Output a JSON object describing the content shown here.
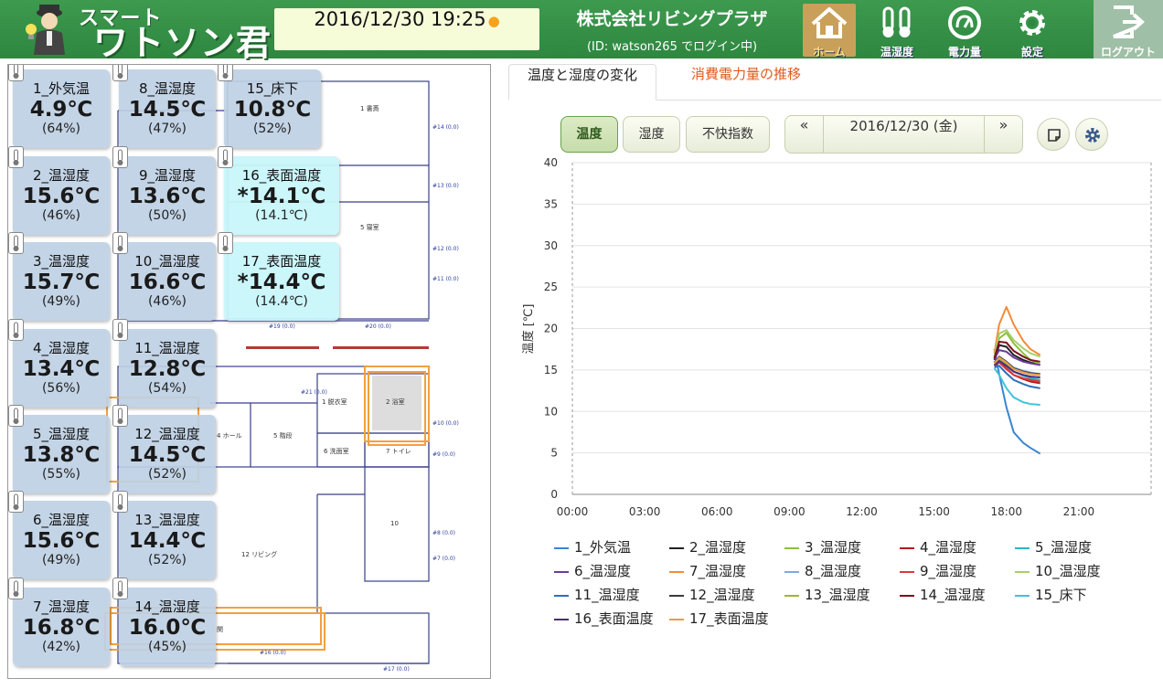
{
  "header": {
    "logo_line1": "スマート",
    "logo_line2": "ワトソン君",
    "datetime": "2016/12/30 19:25",
    "company": "株式会社リビングプラザ",
    "login_id": "(ID: watson265 でログイン中)",
    "nav": [
      {
        "label": "ホーム",
        "icon": "home-icon"
      },
      {
        "label": "温湿度",
        "icon": "thermometer-icon"
      },
      {
        "label": "電力量",
        "icon": "power-meter-icon"
      },
      {
        "label": "設定",
        "icon": "gear-icon"
      }
    ],
    "logout_label": "ログアウト"
  },
  "floorplan_labels": {
    "rooms": [
      "1 書斎",
      "5 寝室",
      "1 脱衣室",
      "2 浴室",
      "4 ホール",
      "5 階段",
      "6 洗面室",
      "7 トイレ",
      "10",
      "12 リビング",
      "関"
    ],
    "markers": [
      "#14 (0.0)",
      "#13 (0.0)",
      "#12 (0.0)",
      "#11 (0.0)",
      "#19 (0.0)",
      "#20 (0.0)",
      "#21 (0.0)",
      "#10 (0.0)",
      "#9 (0.0)",
      "#8 (0.0)",
      "#7 (0.0)",
      "#16 (0.0)",
      "#17 (0.0)"
    ]
  },
  "sensors": [
    {
      "name": "1_外気温",
      "temp": "4.9℃",
      "sub": "(64%)"
    },
    {
      "name": "2_温湿度",
      "temp": "15.6℃",
      "sub": "(46%)"
    },
    {
      "name": "3_温湿度",
      "temp": "15.7℃",
      "sub": "(49%)"
    },
    {
      "name": "4_温湿度",
      "temp": "13.4℃",
      "sub": "(56%)"
    },
    {
      "name": "5_温湿度",
      "temp": "13.8℃",
      "sub": "(55%)"
    },
    {
      "name": "6_温湿度",
      "temp": "15.6℃",
      "sub": "(49%)"
    },
    {
      "name": "7_温湿度",
      "temp": "16.8℃",
      "sub": "(42%)"
    },
    {
      "name": "8_温湿度",
      "temp": "14.5℃",
      "sub": "(47%)"
    },
    {
      "name": "9_温湿度",
      "temp": "13.6℃",
      "sub": "(50%)"
    },
    {
      "name": "10_温湿度",
      "temp": "16.6℃",
      "sub": "(46%)"
    },
    {
      "name": "11_温湿度",
      "temp": "12.8℃",
      "sub": "(54%)"
    },
    {
      "name": "12_温湿度",
      "temp": "14.5℃",
      "sub": "(52%)"
    },
    {
      "name": "13_温湿度",
      "temp": "14.4℃",
      "sub": "(52%)"
    },
    {
      "name": "14_温湿度",
      "temp": "16.0℃",
      "sub": "(45%)"
    },
    {
      "name": "15_床下",
      "temp": "10.8℃",
      "sub": "(52%)"
    },
    {
      "name": "16_表面温度",
      "temp": "*14.1℃",
      "sub": "(14.1℃)"
    },
    {
      "name": "17_表面温度",
      "temp": "*14.4℃",
      "sub": "(14.4℃)"
    }
  ],
  "tabs": [
    "温度と湿度の変化",
    "消費電力量の推移"
  ],
  "toolbar": {
    "temp": "温度",
    "humid": "湿度",
    "discomfort": "不快指数",
    "prev": "«",
    "date": "2016/12/30 (金)",
    "next": "»",
    "note_icon": "note-icon",
    "gear_icon": "gear-icon"
  },
  "chart_data": {
    "type": "line",
    "ylabel": "温度 [℃]",
    "xlabel": "",
    "ylim": [
      0,
      40
    ],
    "yticks": [
      0,
      5,
      10,
      15,
      20,
      25,
      30,
      35,
      40
    ],
    "xticks": [
      "00:00",
      "03:00",
      "06:00",
      "09:00",
      "12:00",
      "15:00",
      "18:00",
      "21:00"
    ],
    "xlim_hours": [
      0,
      24
    ],
    "grid": true,
    "legend_position": "bottom",
    "series": [
      {
        "name": "1_外気温",
        "color": "#3a86d0",
        "x": [
          17.5,
          17.7,
          18.0,
          18.3,
          18.7,
          19.0,
          19.4
        ],
        "y": [
          17.5,
          14.5,
          10.5,
          7.5,
          6.2,
          5.6,
          4.9
        ]
      },
      {
        "name": "2_温湿度",
        "color": "#222222",
        "x": [
          17.5,
          17.7,
          18.0,
          18.3,
          18.7,
          19.0,
          19.4
        ],
        "y": [
          16.2,
          18.0,
          17.8,
          16.8,
          16.2,
          15.9,
          15.6
        ]
      },
      {
        "name": "3_温湿度",
        "color": "#8ebf3f",
        "x": [
          17.5,
          17.7,
          18.0,
          18.3,
          18.7,
          19.0,
          19.4
        ],
        "y": [
          16.5,
          18.8,
          19.5,
          18.2,
          17.0,
          16.2,
          15.7
        ]
      },
      {
        "name": "4_温湿度",
        "color": "#b01c1c",
        "x": [
          17.5,
          17.7,
          18.0,
          18.3,
          18.7,
          19.0,
          19.4
        ],
        "y": [
          15.6,
          16.0,
          15.2,
          14.4,
          13.9,
          13.6,
          13.4
        ]
      },
      {
        "name": "5_温湿度",
        "color": "#2bb4c8",
        "x": [
          17.5,
          17.7,
          18.0,
          18.3,
          18.7,
          19.0,
          19.4
        ],
        "y": [
          15.8,
          16.4,
          15.6,
          14.8,
          14.3,
          14.0,
          13.8
        ]
      },
      {
        "name": "6_温湿度",
        "color": "#6a3d9a",
        "x": [
          17.5,
          17.7,
          18.0,
          18.3,
          18.7,
          19.0,
          19.4
        ],
        "y": [
          16.3,
          17.4,
          17.2,
          16.5,
          16.0,
          15.8,
          15.6
        ]
      },
      {
        "name": "7_温湿度",
        "color": "#f28c38",
        "x": [
          17.5,
          17.7,
          18.0,
          18.3,
          18.7,
          19.0,
          19.4
        ],
        "y": [
          17.0,
          20.5,
          22.6,
          20.5,
          18.5,
          17.5,
          16.8
        ]
      },
      {
        "name": "8_温湿度",
        "color": "#7fa8e0",
        "x": [
          17.5,
          17.7,
          18.0,
          18.3,
          18.7,
          19.0,
          19.4
        ],
        "y": [
          15.8,
          16.6,
          16.0,
          15.3,
          14.9,
          14.7,
          14.5
        ]
      },
      {
        "name": "9_温湿度",
        "color": "#d93a3a",
        "x": [
          17.5,
          17.7,
          18.0,
          18.3,
          18.7,
          19.0,
          19.4
        ],
        "y": [
          15.5,
          15.9,
          15.1,
          14.4,
          14.0,
          13.8,
          13.6
        ]
      },
      {
        "name": "10_温湿度",
        "color": "#a8cf6a",
        "x": [
          17.5,
          17.7,
          18.0,
          18.3,
          18.7,
          19.0,
          19.4
        ],
        "y": [
          16.6,
          19.4,
          19.8,
          18.6,
          17.6,
          17.0,
          16.6
        ]
      },
      {
        "name": "11_温湿度",
        "color": "#2f6fb8",
        "x": [
          17.5,
          17.7,
          18.0,
          18.3,
          18.7,
          19.0,
          19.4
        ],
        "y": [
          15.3,
          15.5,
          14.6,
          13.8,
          13.3,
          13.0,
          12.8
        ]
      },
      {
        "name": "12_温湿度",
        "color": "#3b3b3b",
        "x": [
          17.5,
          17.7,
          18.0,
          18.3,
          18.7,
          19.0,
          19.4
        ],
        "y": [
          15.9,
          16.6,
          16.0,
          15.2,
          14.8,
          14.6,
          14.5
        ]
      },
      {
        "name": "13_温湿度",
        "color": "#9db82a",
        "x": [
          17.5,
          17.7,
          18.0,
          18.3,
          18.7,
          19.0,
          19.4
        ],
        "y": [
          15.8,
          16.4,
          15.8,
          15.1,
          14.7,
          14.5,
          14.4
        ]
      },
      {
        "name": "14_温湿度",
        "color": "#7a1020",
        "x": [
          17.5,
          17.7,
          18.0,
          18.3,
          18.7,
          19.0,
          19.4
        ],
        "y": [
          16.4,
          18.4,
          18.3,
          17.3,
          16.6,
          16.2,
          16.0
        ]
      },
      {
        "name": "15_床下",
        "color": "#3fc4d8",
        "x": [
          17.5,
          17.7,
          18.0,
          18.3,
          18.7,
          19.0,
          19.4
        ],
        "y": [
          15.2,
          14.4,
          12.8,
          11.7,
          11.1,
          10.9,
          10.8
        ]
      },
      {
        "name": "16_表面温度",
        "color": "#4a2c80",
        "x": [
          17.5,
          17.7,
          18.0,
          18.3,
          18.7,
          19.0,
          19.4
        ],
        "y": [
          15.5,
          16.1,
          15.5,
          14.8,
          14.4,
          14.2,
          14.1
        ]
      },
      {
        "name": "17_表面温度",
        "color": "#ee9a4a",
        "x": [
          17.5,
          17.7,
          18.0,
          18.3,
          18.7,
          19.0,
          19.4
        ],
        "y": [
          15.8,
          16.5,
          15.9,
          15.1,
          14.7,
          14.5,
          14.4
        ]
      }
    ]
  }
}
